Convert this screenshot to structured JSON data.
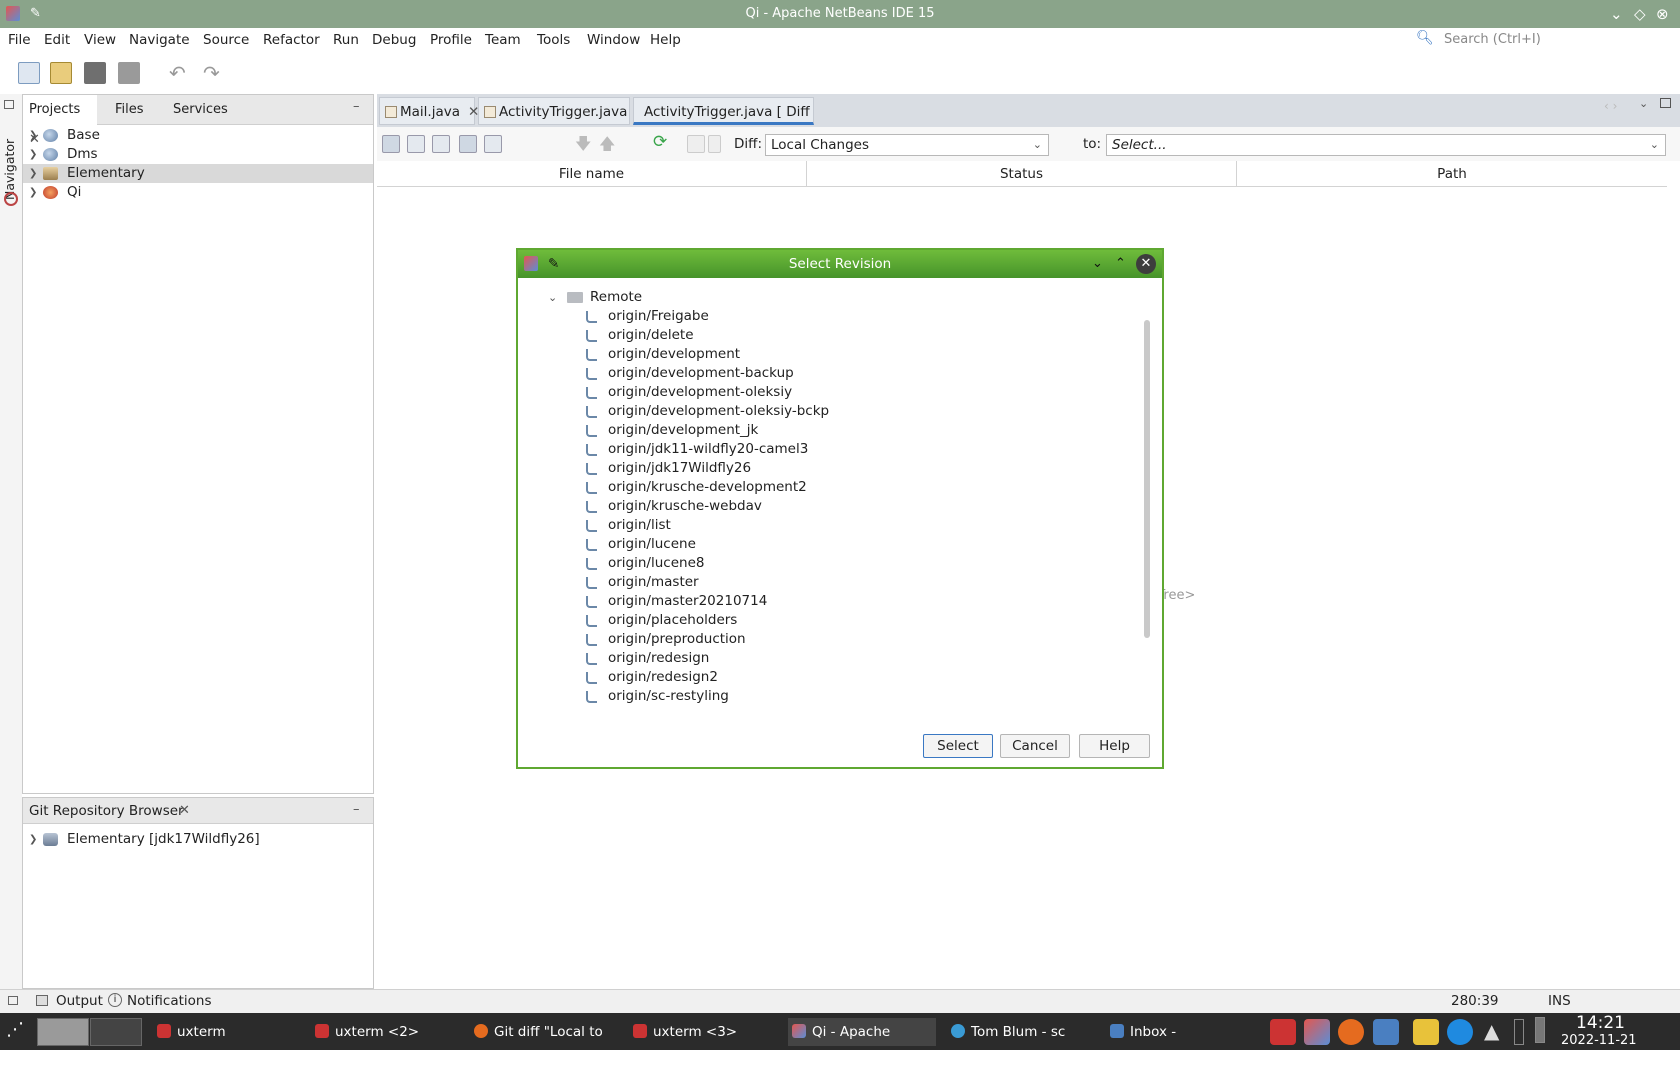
{
  "window": {
    "title": "Qi - Apache NetBeans IDE 15"
  },
  "menu": [
    "File",
    "Edit",
    "View",
    "Navigate",
    "Source",
    "Refactor",
    "Run",
    "Debug",
    "Profile",
    "Team",
    "Tools",
    "Window",
    "Help"
  ],
  "search": {
    "placeholder": "Search (Ctrl+I)"
  },
  "left_strip": {
    "navigator": "Navigator"
  },
  "projects_panel": {
    "tabs": [
      "Projects",
      "Files",
      "Services"
    ],
    "items": [
      "Base",
      "Dms",
      "Elementary",
      "Qi"
    ],
    "selected": "Elementary"
  },
  "git_panel": {
    "title": "Git Repository Browser",
    "items": [
      "Elementary [jdk17Wildfly26]"
    ]
  },
  "editor": {
    "tabs": [
      "Mail.java",
      "ActivityTrigger.java",
      "ActivityTrigger.java [ Diff ]"
    ],
    "active_tab": 2
  },
  "diff_toolbar": {
    "diff_label": "Diff:",
    "diff_value": "Local Changes",
    "to_label": "to:",
    "to_value": "Select..."
  },
  "columns": [
    "File name",
    "Status",
    "Path"
  ],
  "background_hint": "g Tree>",
  "dialog": {
    "title": "Select Revision",
    "group": "Remote",
    "branches": [
      "origin/Freigabe",
      "origin/delete",
      "origin/development",
      "origin/development-backup",
      "origin/development-oleksiy",
      "origin/development-oleksiy-bckp",
      "origin/development_jk",
      "origin/jdk11-wildfly20-camel3",
      "origin/jdk17Wildfly26",
      "origin/krusche-development2",
      "origin/krusche-webdav",
      "origin/list",
      "origin/lucene",
      "origin/lucene8",
      "origin/master",
      "origin/master20210714",
      "origin/placeholders",
      "origin/preproduction",
      "origin/redesign",
      "origin/redesign2",
      "origin/sc-restyling"
    ],
    "buttons": {
      "select": "Select",
      "cancel": "Cancel",
      "help": "Help"
    }
  },
  "status_bar": {
    "output": "Output",
    "notifications": "Notifications",
    "position": "280:39",
    "mode": "INS"
  },
  "taskbar": {
    "tasks": [
      "uxterm",
      "uxterm <2>",
      "Git diff \"Local to R...",
      "uxterm <3>",
      "Qi - Apache NetBe...",
      "Tom Blum - sc syn...",
      "Inbox - ronald.feic..."
    ],
    "time": "14:21",
    "date": "2022-11-21"
  },
  "colors": {
    "title_bar": "#8aa48a",
    "dialog_title": "#5fa831",
    "accent": "#3a78c3",
    "taskbar": "#2b2b2b"
  }
}
